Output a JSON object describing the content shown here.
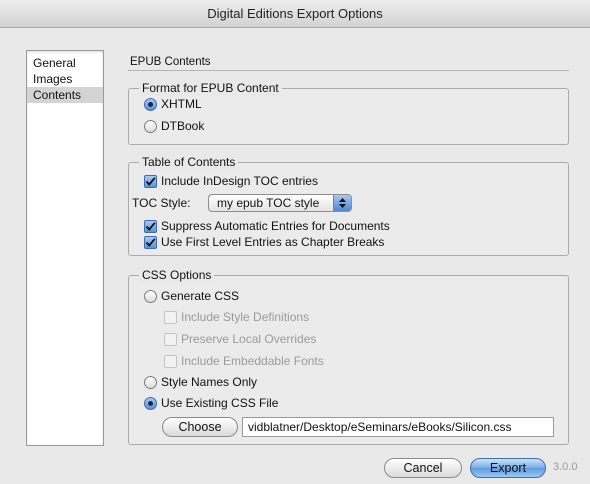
{
  "window": {
    "title": "Digital Editions Export Options"
  },
  "sidebar": {
    "items": [
      {
        "label": "General",
        "selected": false
      },
      {
        "label": "Images",
        "selected": false
      },
      {
        "label": "Contents",
        "selected": true
      }
    ]
  },
  "section": {
    "title": "EPUB Contents"
  },
  "format": {
    "legend": "Format for EPUB Content",
    "options": [
      {
        "label": "XHTML",
        "checked": true
      },
      {
        "label": "DTBook",
        "checked": false
      }
    ]
  },
  "toc": {
    "legend": "Table of Contents",
    "include_label": "Include InDesign TOC entries",
    "include_checked": true,
    "style_label": "TOC Style:",
    "style_value": "my epub TOC style",
    "suppress_label": "Suppress Automatic Entries for Documents",
    "suppress_checked": true,
    "first_level_label": "Use First Level Entries as Chapter Breaks",
    "first_level_checked": true
  },
  "css": {
    "legend": "CSS Options",
    "generate_label": "Generate CSS",
    "generate_checked": false,
    "include_style_label": "Include Style Definitions",
    "preserve_label": "Preserve Local Overrides",
    "embeddable_label": "Include Embeddable Fonts",
    "style_names_label": "Style Names Only",
    "style_names_checked": false,
    "use_existing_label": "Use Existing CSS File",
    "use_existing_checked": true,
    "choose_label": "Choose",
    "path_value": "vidblatner/Desktop/eSeminars/eBooks/Silicon.css"
  },
  "footer": {
    "cancel_label": "Cancel",
    "export_label": "Export",
    "version": "3.0.0"
  },
  "colors": {
    "accent": "#5d93d8",
    "window_bg": "#e9e9e9",
    "disabled_text": "#9a9a9a"
  }
}
